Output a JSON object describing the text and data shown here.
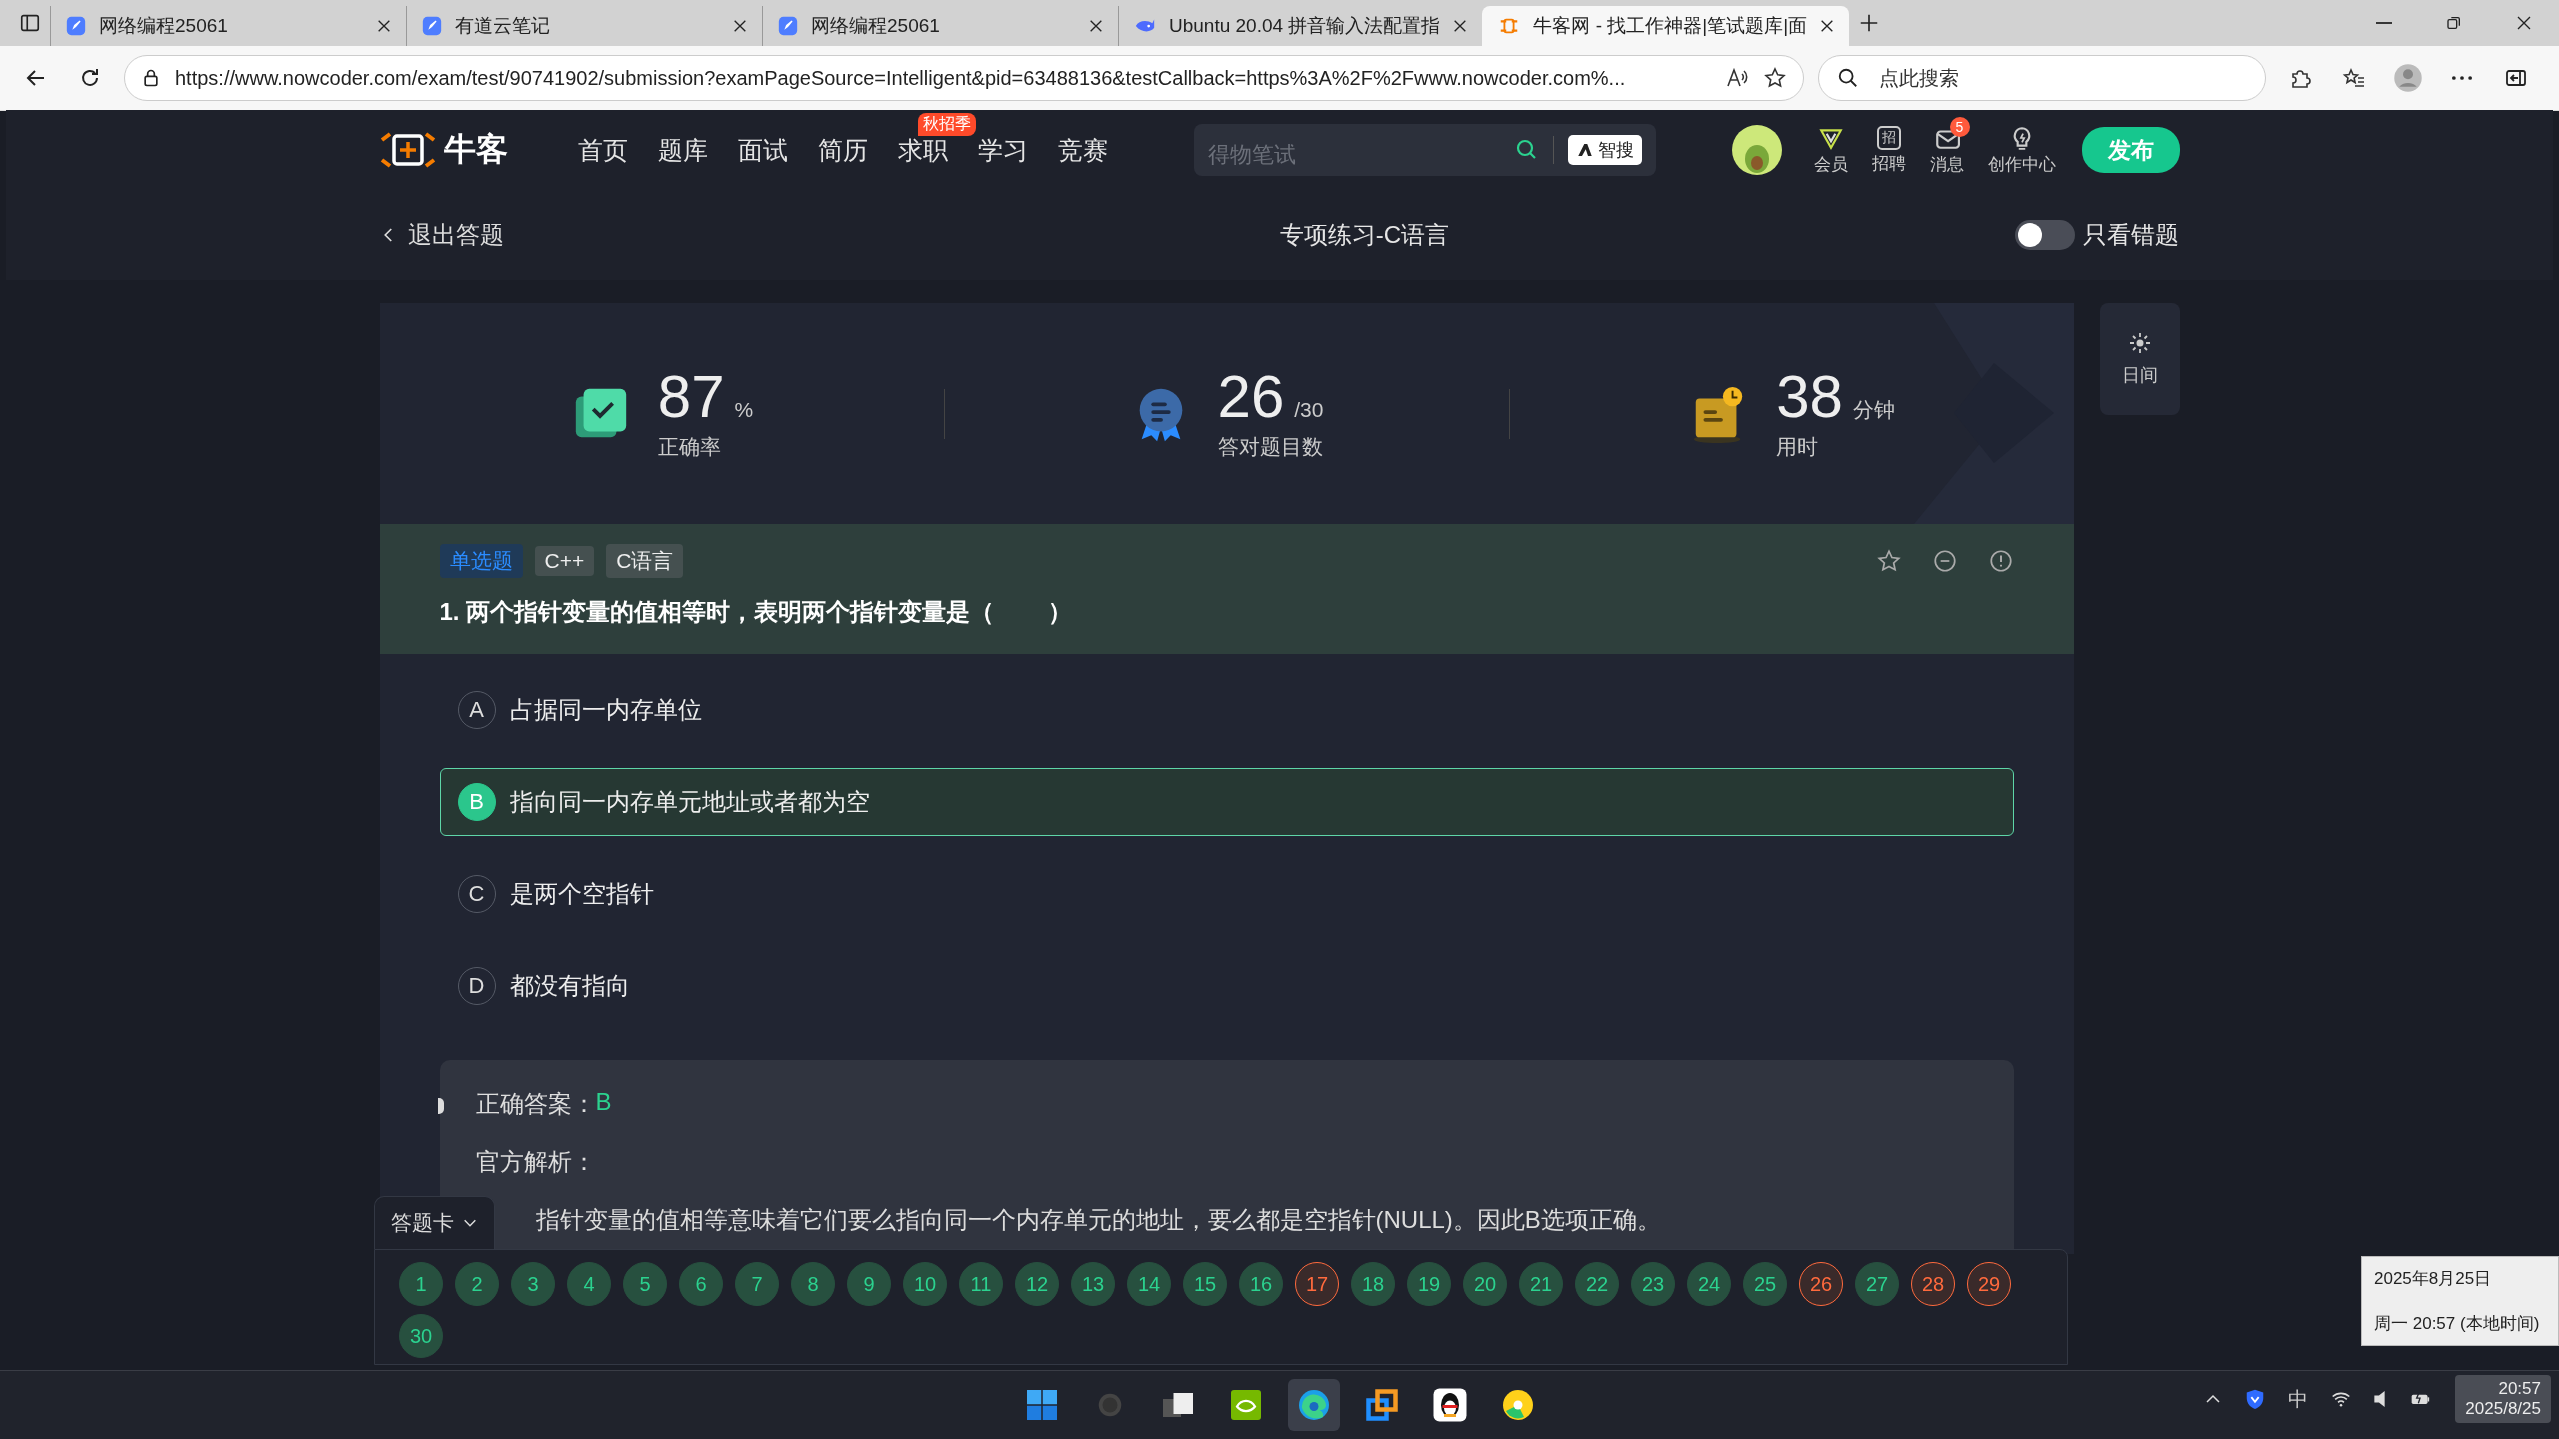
{
  "browser": {
    "tabs": [
      {
        "title": "网络编程25061",
        "kind": "doc",
        "selected": false
      },
      {
        "title": "有道云笔记",
        "kind": "doc",
        "selected": false
      },
      {
        "title": "网络编程25061",
        "kind": "doc",
        "selected": false
      },
      {
        "title": "Ubuntu 20.04 拼音输入法配置指",
        "kind": "whale",
        "selected": false
      },
      {
        "title": "牛客网 - 找工作神器|笔试题库|面",
        "kind": "site",
        "selected": true
      }
    ],
    "url": "https://www.nowcoder.com/exam/test/90741902/submission?examPageSource=Intelligent&pid=63488136&testCallback=https%3A%2F%2Fwww.nowcoder.com%...",
    "search_placeholder": "点此搜索"
  },
  "site_nav": {
    "logo_text": "牛客",
    "items": [
      {
        "label": "首页"
      },
      {
        "label": "题库"
      },
      {
        "label": "面试"
      },
      {
        "label": "简历"
      },
      {
        "label": "求职",
        "badge": "秋招季"
      },
      {
        "label": "学习"
      },
      {
        "label": "竞赛"
      }
    ],
    "search": {
      "placeholder": "得物笔试",
      "ai_button": "智搜"
    },
    "actions": [
      {
        "label": "会员",
        "kind": "vip"
      },
      {
        "label": "招聘",
        "kind": "jobs",
        "icon_text": "招"
      },
      {
        "label": "消息",
        "kind": "message",
        "badge": "5"
      },
      {
        "label": "创作中心",
        "kind": "create"
      }
    ],
    "publish": "发布"
  },
  "subheader": {
    "back": "退出答题",
    "title": "专项练习-C语言",
    "wrong_only": {
      "label": "只看错题",
      "on": false
    }
  },
  "theme_button": {
    "label": "日间"
  },
  "stats": [
    {
      "kind": "accuracy",
      "value": "87",
      "unit": "%",
      "label": "正确率"
    },
    {
      "kind": "correct",
      "value": "26",
      "unit": "/30",
      "label": "答对题目数"
    },
    {
      "kind": "time",
      "value": "38",
      "unit": "分钟",
      "label": "用时"
    }
  ],
  "question": {
    "tags": [
      {
        "label": "单选题",
        "kind": "type"
      },
      {
        "label": "C++",
        "kind": "topic"
      },
      {
        "label": "C语言",
        "kind": "topic"
      }
    ],
    "title": "1. 两个指针变量的值相等时，表明两个指针变量是（        ）",
    "options": [
      {
        "letter": "A",
        "text": "占据同一内存单位",
        "selected": false
      },
      {
        "letter": "B",
        "text": "指向同一内存单元地址或者都为空",
        "selected": true
      },
      {
        "letter": "C",
        "text": "是两个空指针",
        "selected": false
      },
      {
        "letter": "D",
        "text": "都没有指向",
        "selected": false
      }
    ]
  },
  "analysis": {
    "answer_label": "正确答案：",
    "answer": "B",
    "heading": "官方解析：",
    "text": "指针变量的值相等意味着它们要么指向同一个内存单元的地址，要么都是空指针(NULL)。因此B选项正确。"
  },
  "answer_card": {
    "label": "答题卡",
    "items": [
      {
        "number": "1",
        "correct": true
      },
      {
        "number": "2",
        "correct": true
      },
      {
        "number": "3",
        "correct": true
      },
      {
        "number": "4",
        "correct": true
      },
      {
        "number": "5",
        "correct": true
      },
      {
        "number": "6",
        "correct": true
      },
      {
        "number": "7",
        "correct": true
      },
      {
        "number": "8",
        "correct": true
      },
      {
        "number": "9",
        "correct": true
      },
      {
        "number": "10",
        "correct": true
      },
      {
        "number": "11",
        "correct": true
      },
      {
        "number": "12",
        "correct": true
      },
      {
        "number": "13",
        "correct": true
      },
      {
        "number": "14",
        "correct": true
      },
      {
        "number": "15",
        "correct": true
      },
      {
        "number": "16",
        "correct": true
      },
      {
        "number": "17",
        "correct": false
      },
      {
        "number": "18",
        "correct": true
      },
      {
        "number": "19",
        "correct": true
      },
      {
        "number": "20",
        "correct": true
      },
      {
        "number": "21",
        "correct": true
      },
      {
        "number": "22",
        "correct": true
      },
      {
        "number": "23",
        "correct": true
      },
      {
        "number": "24",
        "correct": true
      },
      {
        "number": "25",
        "correct": true
      },
      {
        "number": "26",
        "correct": false
      },
      {
        "number": "27",
        "correct": true
      },
      {
        "number": "28",
        "correct": false
      },
      {
        "number": "29",
        "correct": false
      },
      {
        "number": "30",
        "correct": true
      }
    ]
  },
  "date_tooltip": {
    "date": "2025年8月25日",
    "detail": "周一 20:57 (本地时间)"
  },
  "taskbar": {
    "apps": [
      {
        "kind": "start",
        "active": false
      },
      {
        "kind": "search",
        "active": false
      },
      {
        "kind": "files",
        "active": false
      },
      {
        "kind": "nvidia",
        "active": false
      },
      {
        "kind": "edge",
        "active": true
      },
      {
        "kind": "remote",
        "active": false
      },
      {
        "kind": "penguin",
        "active": false
      },
      {
        "kind": "music",
        "active": false
      }
    ],
    "tray": {
      "ime": "中",
      "time": "20:57",
      "date": "2025/8/25"
    }
  }
}
